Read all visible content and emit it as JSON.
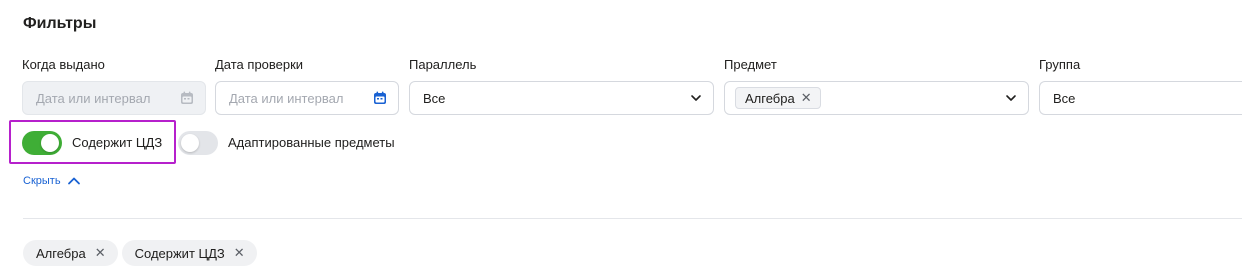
{
  "filters": {
    "title": "Фильтры",
    "issued": {
      "label": "Когда выдано",
      "placeholder": "Дата или интервал"
    },
    "checked": {
      "label": "Дата проверки",
      "placeholder": "Дата или интервал"
    },
    "parallel": {
      "label": "Параллель",
      "value": "Все"
    },
    "subject": {
      "label": "Предмет",
      "chip": "Алгебра"
    },
    "group": {
      "label": "Группа",
      "value": "Все"
    },
    "toggles": [
      {
        "label": "Содержит ЦДЗ",
        "on": true
      },
      {
        "label": "Адаптированные предметы",
        "on": false
      }
    ],
    "collapse_label": "Скрыть"
  },
  "active_tags": [
    "Алгебра",
    "Содержит ЦДЗ"
  ],
  "colors": {
    "toggle_on": "#3fae36",
    "highlight": "#b620cc",
    "link": "#1962d3",
    "calendar_active": "#1962d3"
  },
  "icons": {
    "calendar": "calendar-icon",
    "dropdown": "chevron-down-icon",
    "collapse": "chevron-up-icon",
    "remove": "close-icon"
  }
}
